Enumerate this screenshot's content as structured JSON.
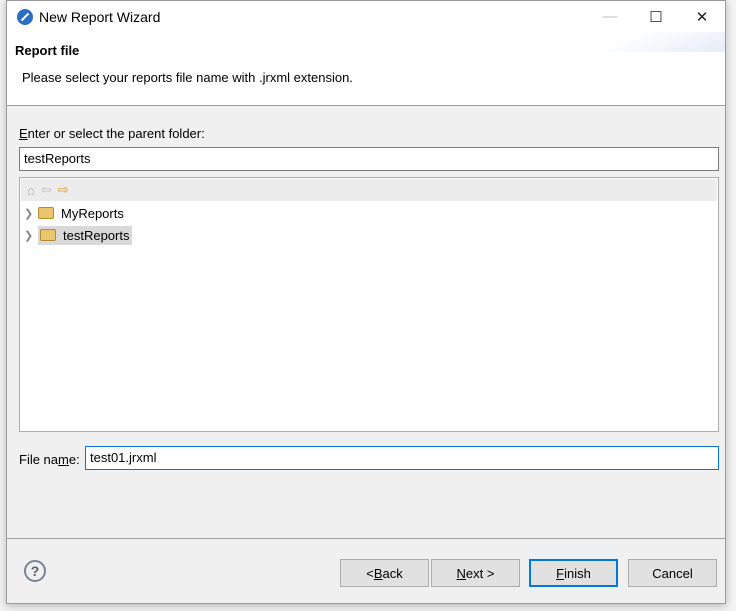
{
  "window": {
    "title": "New Report Wizard",
    "minimize": "—",
    "maximize": "☐",
    "close": "✕"
  },
  "header": {
    "title": "Report file",
    "description": "Please select your reports file name with .jrxml extension."
  },
  "folder": {
    "label_mnemonic": "E",
    "label_rest": "nter or select the parent folder:",
    "value": "testReports"
  },
  "tree": {
    "toolbar": {
      "home": "⌂",
      "back": "⇦",
      "forward": "⇨"
    },
    "items": [
      {
        "label": "MyReports",
        "selected": false
      },
      {
        "label": "testReports",
        "selected": true
      }
    ]
  },
  "file": {
    "label_pre": "File na",
    "label_mnemonic": "m",
    "label_post": "e:",
    "value": "test01.jrxml"
  },
  "buttons": {
    "help": "?",
    "back_pre": "< ",
    "back_m": "B",
    "back_post": "ack",
    "next_m": "N",
    "next_post": "ext >",
    "finish_m": "F",
    "finish_post": "inish",
    "cancel": "Cancel"
  },
  "colors": {
    "accent": "#0078d7"
  }
}
